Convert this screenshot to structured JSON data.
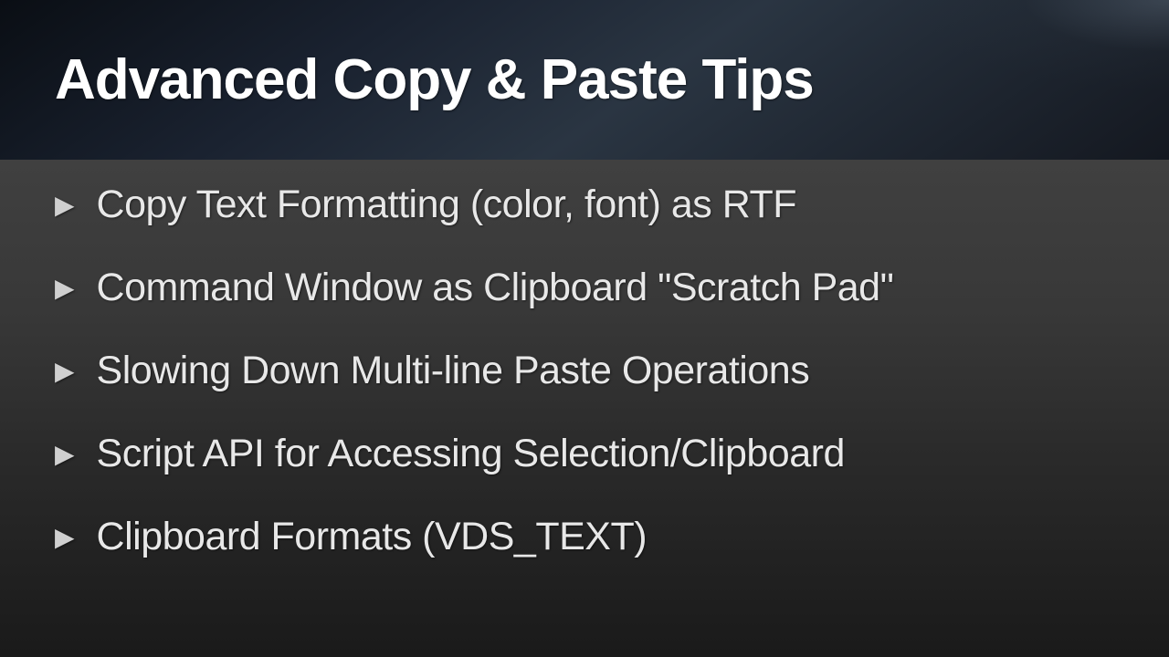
{
  "slide": {
    "title": "Advanced Copy & Paste Tips",
    "bullets": [
      "Copy Text Formatting (color, font) as RTF",
      "Command Window as Clipboard \"Scratch Pad\"",
      "Slowing Down Multi-line Paste Operations",
      "Script API for Accessing Selection/Clipboard",
      "Clipboard Formats (VDS_TEXT)"
    ]
  }
}
